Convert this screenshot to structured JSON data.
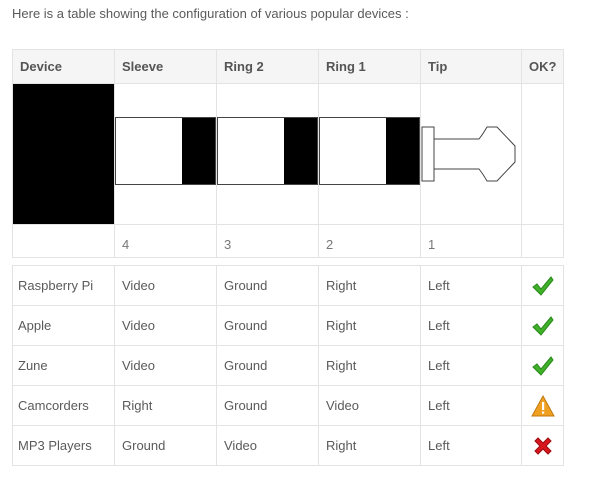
{
  "intro_text": "Here is a table showing the configuration of various popular devices :",
  "headers": [
    "Device",
    "Sleeve",
    "Ring 2",
    "Ring 1",
    "Tip",
    "OK?"
  ],
  "pin_numbers": [
    "",
    "4",
    "3",
    "2",
    "1",
    ""
  ],
  "rows": [
    {
      "device": "Raspberry Pi",
      "sleeve": "Video",
      "ring2": "Ground",
      "ring1": "Right",
      "tip": "Left",
      "status": "ok",
      "status_icon": "green-checkmark-icon"
    },
    {
      "device": "Apple",
      "sleeve": "Video",
      "ring2": "Ground",
      "ring1": "Right",
      "tip": "Left",
      "status": "ok",
      "status_icon": "green-checkmark-icon"
    },
    {
      "device": "Zune",
      "sleeve": "Video",
      "ring2": "Ground",
      "ring1": "Right",
      "tip": "Left",
      "status": "ok",
      "status_icon": "green-checkmark-icon"
    },
    {
      "device": "Camcorders",
      "sleeve": "Right",
      "ring2": "Ground",
      "ring1": "Video",
      "tip": "Left",
      "status": "warning",
      "status_icon": "warning-triangle-icon"
    },
    {
      "device": "MP3 Players",
      "sleeve": "Ground",
      "ring2": "Video",
      "ring1": "Right",
      "tip": "Left",
      "status": "error",
      "status_icon": "red-cross-icon"
    }
  ],
  "colors": {
    "ok": "#3fae29",
    "warning": "#f0a020",
    "error": "#d8161c",
    "header_bg": "#f5f5f5",
    "border": "#e3e3e3"
  }
}
